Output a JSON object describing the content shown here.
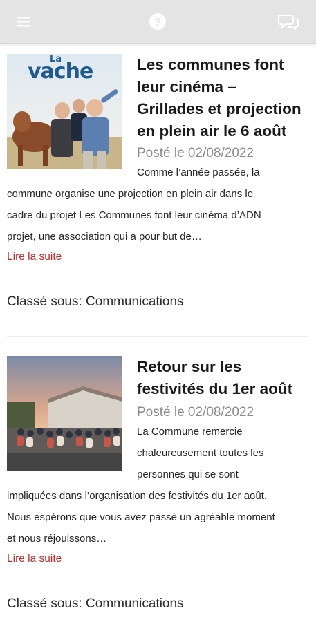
{
  "topbar": {
    "menu_icon": "hamburger-menu-icon",
    "help_icon": "question-circle-icon",
    "chat_icon": "chat-bubbles-icon",
    "background": "#e4e4e4",
    "icon_color": "#ffffff"
  },
  "articles": [
    {
      "image_icon": "movie-poster-image",
      "poster_small": "La",
      "poster_big": "vache",
      "title_lines": [
        "Les communes font",
        "leur cinéma –",
        "Grillades et projection",
        "en plein air le 6 août"
      ],
      "date": "Posté le 02/08/2022",
      "lead": "Comme l’année passée, la",
      "body_lines": [
        "commune organise une projection en plein air dans le",
        "cadre du projet Les Communes font leur cinéma d’ADN",
        "projet, une association qui a pour but de…"
      ],
      "read_more": "Lire la suite",
      "category": "Classé sous: Communications"
    },
    {
      "image_icon": "festival-crowd-photo",
      "title_lines": [
        "Retour sur les",
        "festivités du 1er août"
      ],
      "date": "Posté le 02/08/2022",
      "lead_lines": [
        "La Commune remercie",
        "chaleureusement toutes les",
        "personnes qui se sont"
      ],
      "body_lines": [
        "impliquées dans l’organisation des festivités du 1er août.",
        "Nous espérons que vous avez passé un agréable moment",
        "et nous réjouissons…"
      ],
      "read_more": "Lire la suite",
      "category": "Classé sous: Communications"
    }
  ],
  "colors": {
    "accent": "#b5302f",
    "date": "#8b8b8b"
  }
}
